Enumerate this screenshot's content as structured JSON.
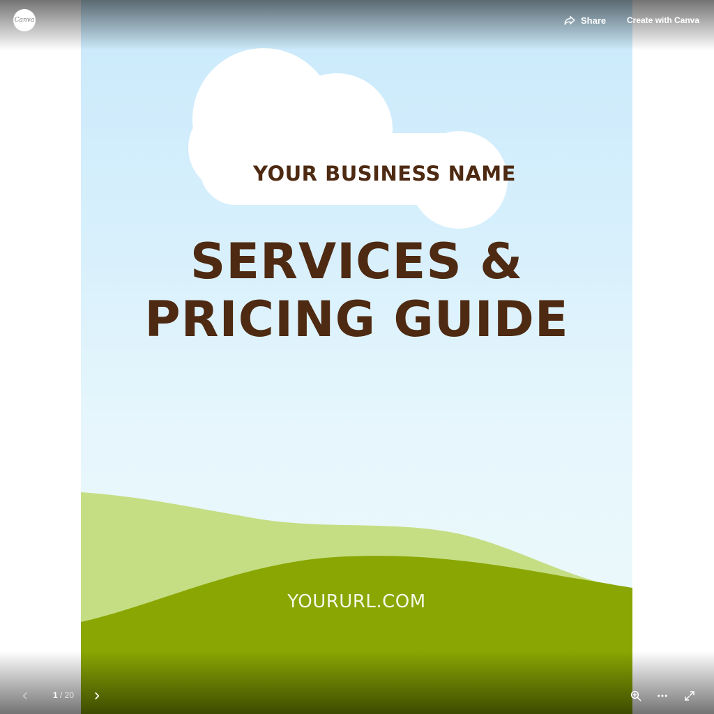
{
  "viewer": {
    "logo_text": "Canva",
    "share_label": "Share",
    "create_label": "Create with Canva",
    "page_current": "1",
    "page_separator": "/",
    "page_total": "20"
  },
  "slide": {
    "business_name": "YOUR BUSINESS NAME",
    "headline_line1": "SERVICES &",
    "headline_line2": "PRICING GUIDE",
    "url_text": "YOURURL.COM"
  },
  "icons": {
    "share": "share-arrow-icon",
    "prev": "chevron-left-icon",
    "next": "chevron-right-icon",
    "zoom": "zoom-in-icon",
    "more": "more-dots-icon",
    "fullscreen": "fullscreen-icon"
  },
  "colors": {
    "headline": "#4e2a12",
    "sky_top": "#c9e9fb",
    "sky_bottom": "#eaf8fb",
    "hill_light": "#c5de84",
    "hill_dark": "#89a602",
    "url_text": "#f4f8e6"
  }
}
